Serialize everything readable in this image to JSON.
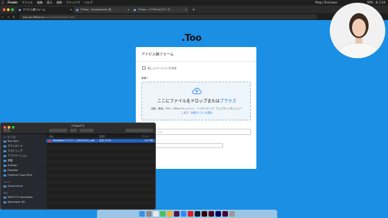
{
  "menubar": {
    "app": "Finder",
    "items": [
      "ファイル",
      "編集",
      "表示",
      "移動",
      "ウインドウ",
      "ヘルプ"
    ],
    "status_items": [
      "99%",
      "木 1:34"
    ]
  },
  "browser": {
    "tabs": [
      {
        "label": "アドビ入稿フォーム"
      },
      {
        "label": "2Tflow - TooAdobeInfo 見..."
      },
      {
        "label": "2Tflow - CC7Proのスマーク..."
      }
    ],
    "url_host": "too-sol.2tflow.io",
    "url_path": "/forms/adobe/9bb0-4eb",
    "new_tab": "+"
  },
  "page": {
    "logo": ".Too",
    "form_title": "アドビ入稿フォーム",
    "new_version_label": "新しいバージョンを作成",
    "file_label": "原稿 *",
    "dropzone": {
      "main": "ここにファイルをドロップまたは",
      "browse": "ブラウズ",
      "sub1": "画像、動画、PDF、Officeドキュメント、リッチメディア、ウェブサイトをレビュー",
      "sub2_prefix": "します。",
      "sub2_link": "対象なリストを表示"
    },
    "input_placeholder": "入力"
  },
  "finder": {
    "title": "2Tflowデモ",
    "sidebar": {
      "sections": [
        {
          "header": "よく使う項目",
          "items": [
            "Box Sync",
            "ダウンロード",
            "デスクトップ",
            "アプリケーション",
            "書類",
            "AirDrop",
            "Dropbox",
            "Creative Cloud Files"
          ]
        },
        {
          "header": "iCloud",
          "items": [
            "iCloud Drive"
          ]
        },
        {
          "header": "場所",
          "items": [
            "MG07717-tomizawa",
            "Macintosh HD"
          ]
        }
      ]
    },
    "columns": [
      "名前",
      "変更日",
      "サイズ"
    ],
    "files": [
      {
        "name": "TooAdobeフライヤー_20231410_.pdf",
        "date": "今日 13:31",
        "size": "4.2 MB"
      }
    ]
  },
  "webcam": {
    "label": "Megu Tomizawa"
  },
  "colors": {
    "page_bg": "#1a8fe3",
    "link": "#1a73e8",
    "selection": "#2463c9"
  }
}
